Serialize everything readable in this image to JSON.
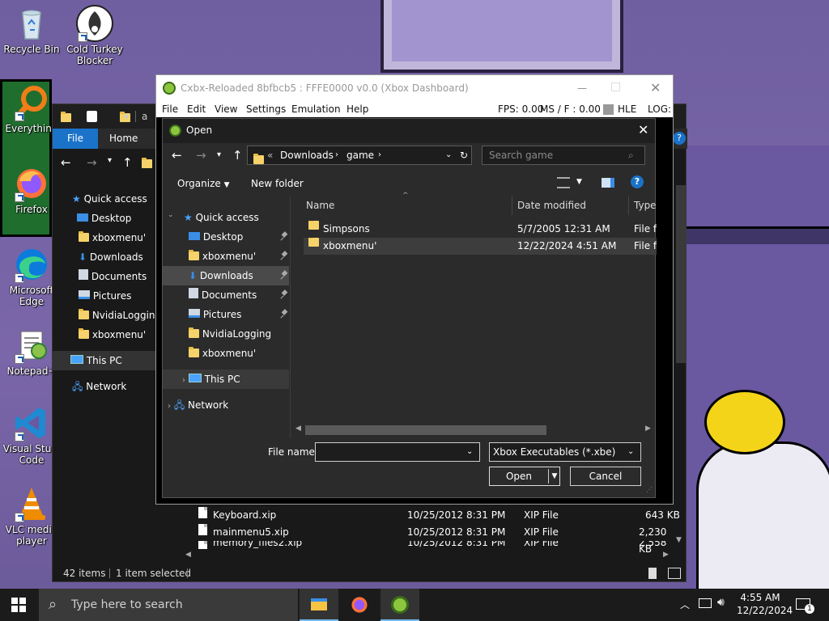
{
  "desktop": {
    "icons": [
      {
        "label": "Recycle Bin",
        "icon": "recycle-bin-icon"
      },
      {
        "label": "Cold Turkey Blocker",
        "icon": "cold-turkey-icon"
      },
      {
        "label": "Everything",
        "icon": "everything-search-icon"
      },
      {
        "label": "Firefox",
        "icon": "firefox-icon"
      },
      {
        "label": "Microsoft Edge",
        "icon": "edge-icon"
      },
      {
        "label": "Notepad++",
        "icon": "notepadpp-icon"
      },
      {
        "label": "Visual Studio Code",
        "icon": "vscode-icon"
      },
      {
        "label": "VLC media player",
        "icon": "vlc-icon"
      }
    ],
    "labels": {
      "recycle": "Recycle Bin",
      "coldturkey1": "Cold Turkey",
      "coldturkey2": "Blocker",
      "everything": "Everything",
      "firefox": "Firefox",
      "edge1": "Microsoft",
      "edge2": "Edge",
      "notepad": "Notepad+",
      "vscode1": "Visual Studi",
      "vscode2": "Code",
      "vlc1": "VLC media",
      "vlc2": "player"
    }
  },
  "explorer": {
    "title_fragment": "a",
    "tabs": {
      "file": "File",
      "home": "Home"
    },
    "nav": [
      {
        "label": "Quick access",
        "icon": "star-icon"
      },
      {
        "label": "Desktop",
        "icon": "desktop-icon"
      },
      {
        "label": "xboxmenu'",
        "icon": "folder-icon"
      },
      {
        "label": "Downloads",
        "icon": "download-icon"
      },
      {
        "label": "Documents",
        "icon": "documents-icon"
      },
      {
        "label": "Pictures",
        "icon": "pictures-icon"
      },
      {
        "label": "NvidiaLogging",
        "icon": "folder-icon"
      },
      {
        "label": "xboxmenu'",
        "icon": "folder-icon"
      },
      {
        "label": "This PC",
        "icon": "pc-icon"
      },
      {
        "label": "Network",
        "icon": "network-icon"
      }
    ],
    "files": [
      {
        "name": "Keyboard.xip",
        "date": "10/25/2012 8:31 PM",
        "type": "XIP File",
        "size": "643 KB"
      },
      {
        "name": "mainmenu5.xip",
        "date": "10/25/2012 8:31 PM",
        "type": "XIP File",
        "size": "2,230 KB"
      },
      {
        "name": "memory_files2.xip",
        "date": "10/25/2012 8:31 PM",
        "type": "XIP File",
        "size": "2,558 KB"
      }
    ],
    "status": {
      "items": "42 items",
      "selected": "1 item selected"
    }
  },
  "cxbx": {
    "title": "Cxbx-Reloaded 8bfbcb5 : FFFE0000 v0.0 (Xbox Dashboard)",
    "menu": [
      "File",
      "Edit",
      "View",
      "Settings",
      "Emulation",
      "Help"
    ],
    "fps": "FPS: 0.00",
    "ms": "MS / F : 0.00",
    "hle": "HLE",
    "log": "LOG:"
  },
  "dialog": {
    "title": "Open",
    "path": {
      "prefix": "«",
      "part1": "Downloads",
      "part2": "game"
    },
    "search_placeholder": "Search game",
    "organize": "Organize",
    "new_folder": "New folder",
    "nav": [
      {
        "label": "Quick access",
        "icon": "star-icon",
        "pinned": false
      },
      {
        "label": "Desktop",
        "icon": "desktop-icon",
        "pinned": true
      },
      {
        "label": "xboxmenu'",
        "icon": "folder-icon",
        "pinned": true
      },
      {
        "label": "Downloads",
        "icon": "download-icon",
        "pinned": true,
        "selected": true
      },
      {
        "label": "Documents",
        "icon": "documents-icon",
        "pinned": true
      },
      {
        "label": "Pictures",
        "icon": "pictures-icon",
        "pinned": true
      },
      {
        "label": "NvidiaLogging",
        "icon": "folder-icon",
        "pinned": false
      },
      {
        "label": "xboxmenu'",
        "icon": "folder-icon",
        "pinned": false
      },
      {
        "label": "This PC",
        "icon": "pc-icon",
        "pinned": false
      },
      {
        "label": "Network",
        "icon": "network-icon",
        "pinned": false
      }
    ],
    "columns": {
      "name": "Name",
      "date": "Date modified",
      "type": "Type"
    },
    "files": [
      {
        "name": "Simpsons",
        "date": "5/7/2005 12:31 AM",
        "type": "File fo"
      },
      {
        "name": "xboxmenu'",
        "date": "12/22/2024 4:51 AM",
        "type": "File fo"
      }
    ],
    "file_name_label": "File name:",
    "file_name_value": "",
    "filter": "Xbox Executables (*.xbe)",
    "open_button": "Open",
    "cancel_button": "Cancel"
  },
  "taskbar": {
    "search_placeholder": "Type here to search",
    "apps": [
      "file-explorer-icon",
      "firefox-icon",
      "cxbx-icon"
    ],
    "time": "4:55 AM",
    "date": "12/22/2024",
    "notification_count": "1"
  }
}
